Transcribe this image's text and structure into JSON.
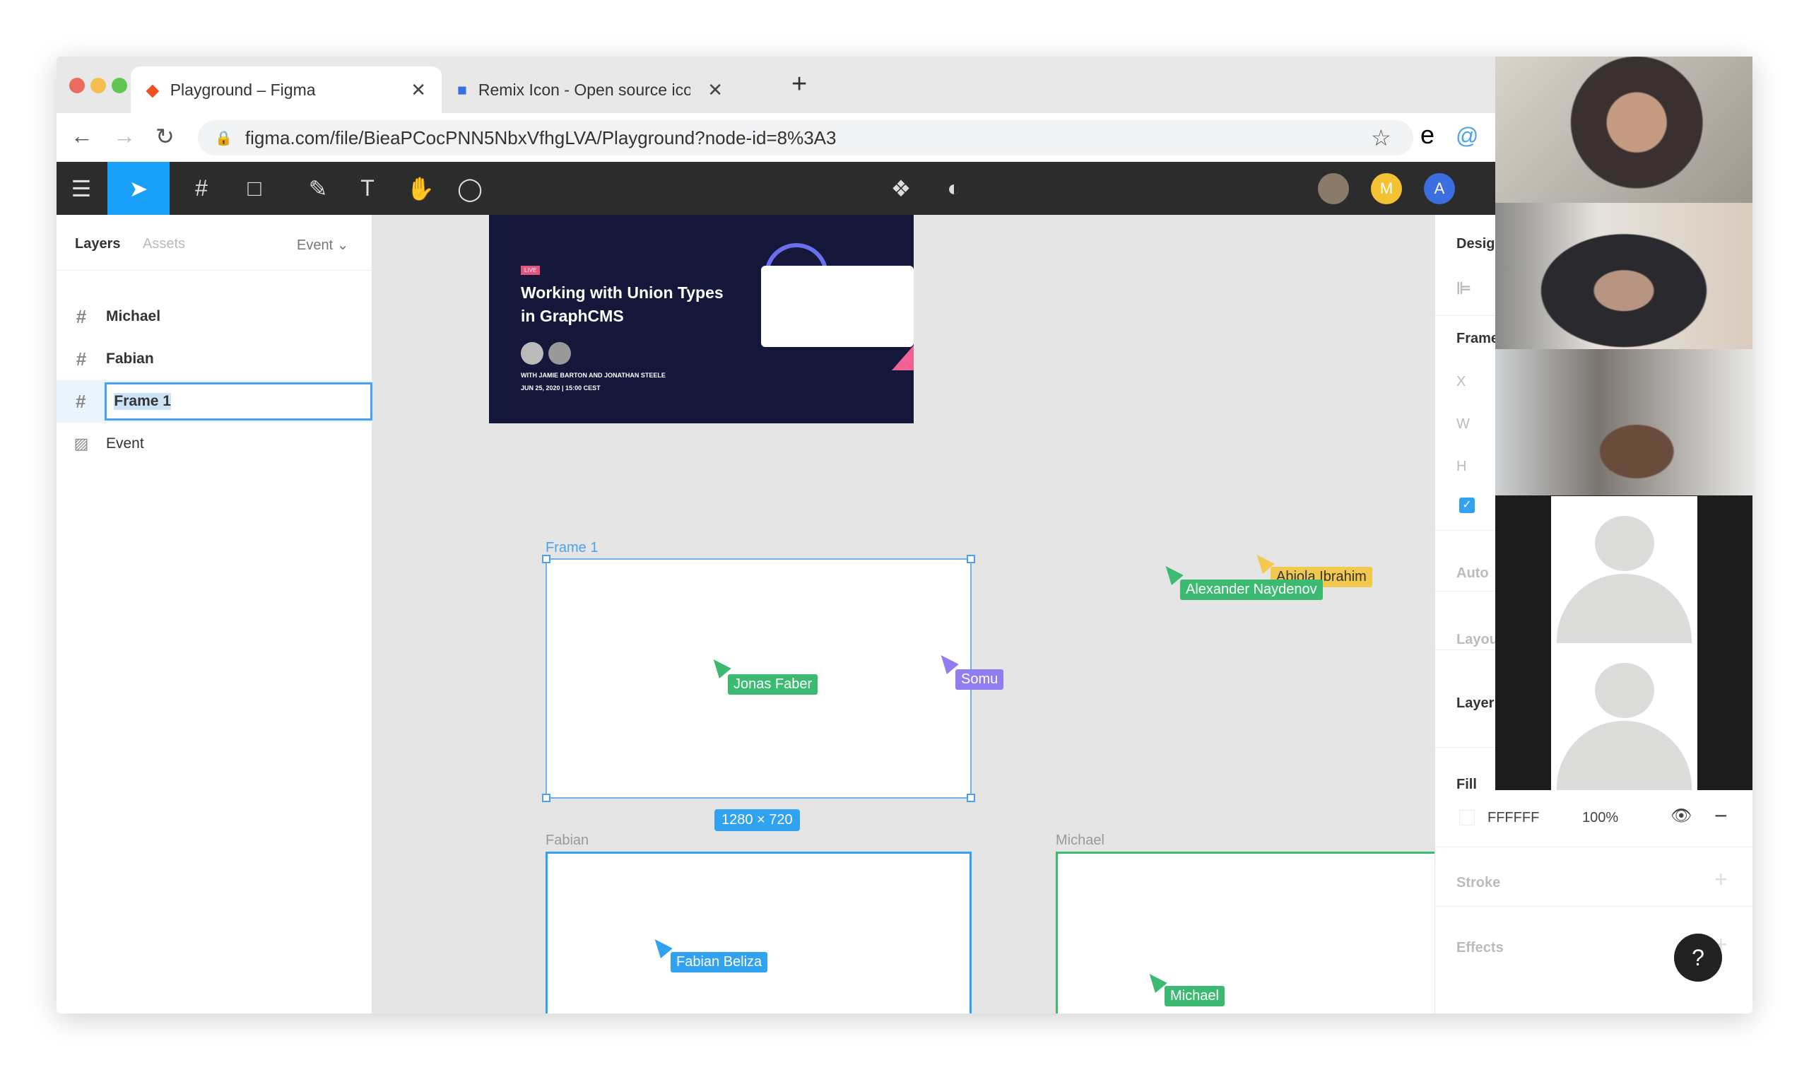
{
  "browser": {
    "tabs": [
      {
        "title": "Playground – Figma",
        "active": true
      },
      {
        "title": "Remix Icon - Open source icon",
        "active": false
      }
    ],
    "new_tab": "+",
    "close": "✕",
    "url": "figma.com/file/BieaPCocPNN5NbxVfhgLVA/Playground?node-id=8%3A3",
    "extension_letter": "e"
  },
  "toolbar": {
    "avatars": [
      {
        "letter": "",
        "color": "#8a7a6a"
      },
      {
        "letter": "M",
        "color": "#f2c233"
      },
      {
        "letter": "A",
        "color": "#3b6fe0"
      }
    ],
    "accent": "#18a0fb"
  },
  "left_panel": {
    "tabs": [
      "Layers",
      "Assets"
    ],
    "page": "Event",
    "layers": [
      {
        "name": "Michael",
        "icon": "frame-icon"
      },
      {
        "name": "Fabian",
        "icon": "frame-icon"
      },
      {
        "name": "Frame 1",
        "icon": "frame-icon",
        "editing": true
      },
      {
        "name": "Event",
        "icon": "image-icon"
      }
    ]
  },
  "canvas": {
    "event_card": {
      "badge": "LIVE",
      "title_line1": "Working with Union Types",
      "title_line2": "in GraphCMS",
      "speakers": "WITH JAMIE BARTON AND JONATHAN STEELE",
      "date": "JUN 25, 2020 | 15:00 CEST"
    },
    "frames": {
      "frame1": "Frame 1",
      "fabian": "Fabian",
      "michael": "Michael"
    },
    "size_badge": "1280 × 720",
    "cursors": [
      {
        "name": "Jonas Faber",
        "color": "#3dba72"
      },
      {
        "name": "Somu",
        "color": "#8f7ef0"
      },
      {
        "name": "Alexander Naydenov",
        "color": "#3dba72"
      },
      {
        "name": "Abiola Ibrahim",
        "color": "#f2c94c"
      },
      {
        "name": "Fabian Beliza",
        "color": "#30a2f0"
      },
      {
        "name": "Michael",
        "color": "#3dba72"
      }
    ]
  },
  "right_panel": {
    "design": "Desig",
    "frame": "Frame",
    "x": "X",
    "w": "W",
    "h": "H",
    "clip_checked": true,
    "auto": "Auto",
    "layout": "Layou",
    "layer": "Layer",
    "fill": {
      "label": "Fill",
      "hex": "FFFFFF",
      "opacity": "100%"
    },
    "stroke": "Stroke",
    "effects": "Effects",
    "help": "?"
  }
}
